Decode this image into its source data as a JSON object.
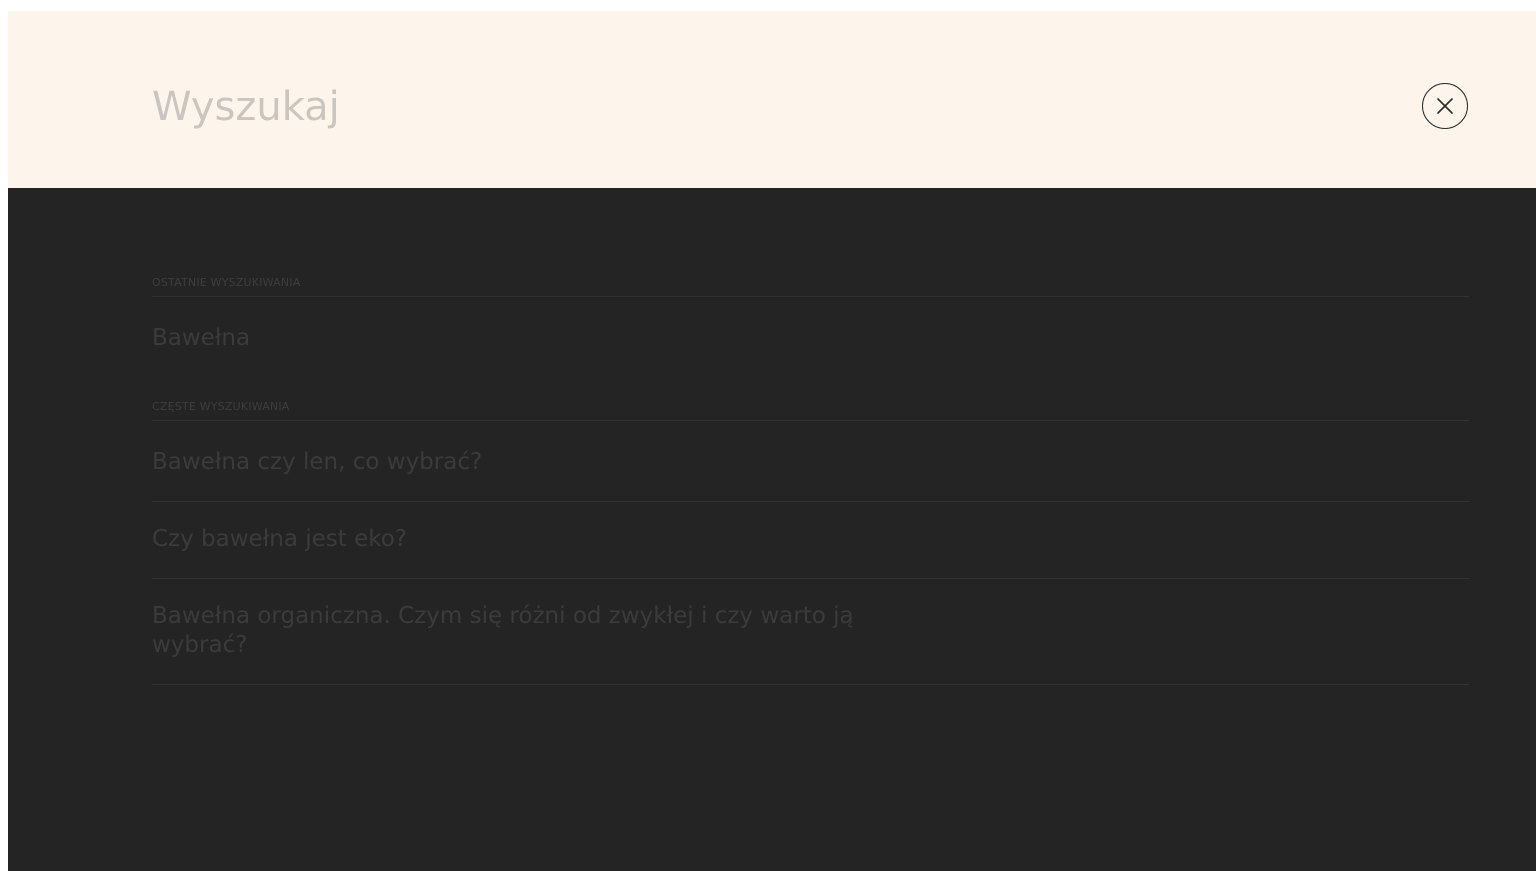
{
  "search": {
    "placeholder": "Wyszukaj",
    "close_label": "×"
  },
  "recent": {
    "heading": "OSTATNIE WYSZUKIWANIA",
    "items": [
      "Bawełna"
    ]
  },
  "frequent": {
    "heading": "CZĘSTE WYSZUKIWANIA",
    "items": [
      "Bawełna czy len, co wybrać?",
      "Czy bawełna jest eko?",
      "Bawełna organiczna. Czym się różni od zwykłej i czy warto ją wybrać?"
    ]
  },
  "colors": {
    "search_bar_bg": "#fdf5ec",
    "overlay_bg": "#242424",
    "muted_text": "#3b3b3b",
    "divider": "#323232"
  }
}
